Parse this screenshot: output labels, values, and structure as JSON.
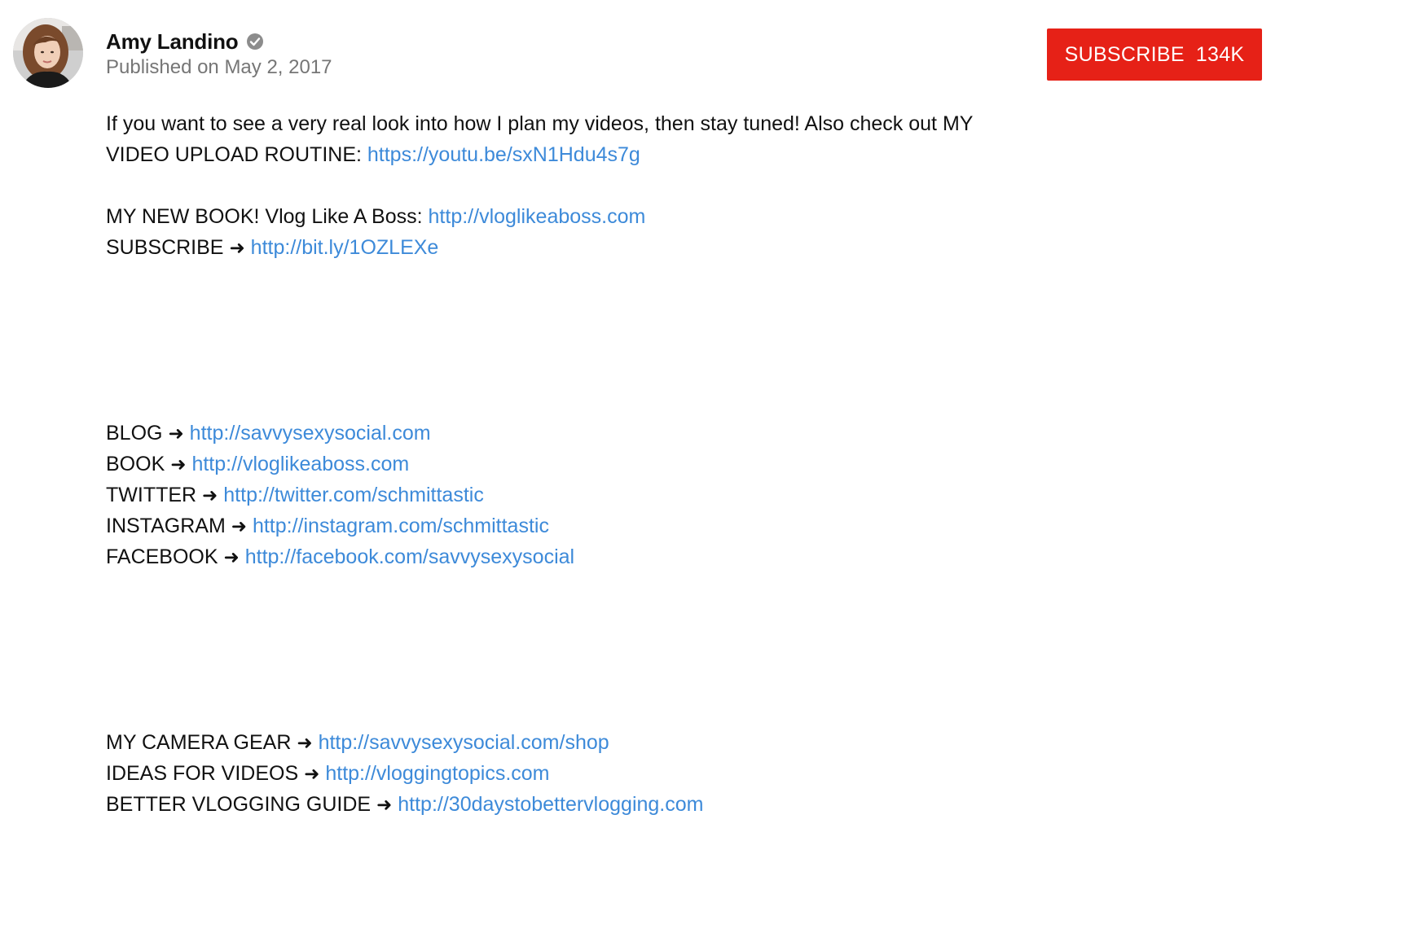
{
  "channel": {
    "name": "Amy Landino",
    "published": "Published on May 2, 2017"
  },
  "subscribe": {
    "label": "SUBSCRIBE",
    "count": "134K"
  },
  "description": {
    "intro_line1": "If you want to see a very real look into how I plan my videos, then stay tuned! Also check out MY",
    "intro_line2_label": "VIDEO UPLOAD ROUTINE: ",
    "intro_line2_link": "https://youtu.be/sxN1Hdu4s7g",
    "book_label": "MY NEW BOOK! Vlog Like A Boss: ",
    "book_link": "http://vloglikeaboss.com",
    "subscribe_label": "SUBSCRIBE",
    "subscribe_link": "http://bit.ly/1OZLEXe",
    "arrow": "➜",
    "social_links": [
      {
        "label": "BLOG",
        "url": "http://savvysexysocial.com"
      },
      {
        "label": "BOOK",
        "url": "http://vloglikeaboss.com"
      },
      {
        "label": "TWITTER",
        "url": "http://twitter.com/schmittastic"
      },
      {
        "label": "INSTAGRAM",
        "url": "http://instagram.com/schmittastic"
      },
      {
        "label": "FACEBOOK",
        "url": "http://facebook.com/savvysexysocial"
      }
    ],
    "resource_links": [
      {
        "label": "MY CAMERA GEAR",
        "url": "http://savvysexysocial.com/shop"
      },
      {
        "label": "IDEAS FOR VIDEOS",
        "url": "http://vloggingtopics.com"
      },
      {
        "label": "BETTER VLOGGING GUIDE",
        "url": "http://30daystobettervlogging.com"
      }
    ]
  },
  "colors": {
    "subscribe_red": "#e62117",
    "link_blue": "#3d8ad9",
    "secondary_text": "#767676"
  },
  "icons": {
    "verified": "verified-check-icon",
    "arrow": "right-arrow-icon"
  }
}
